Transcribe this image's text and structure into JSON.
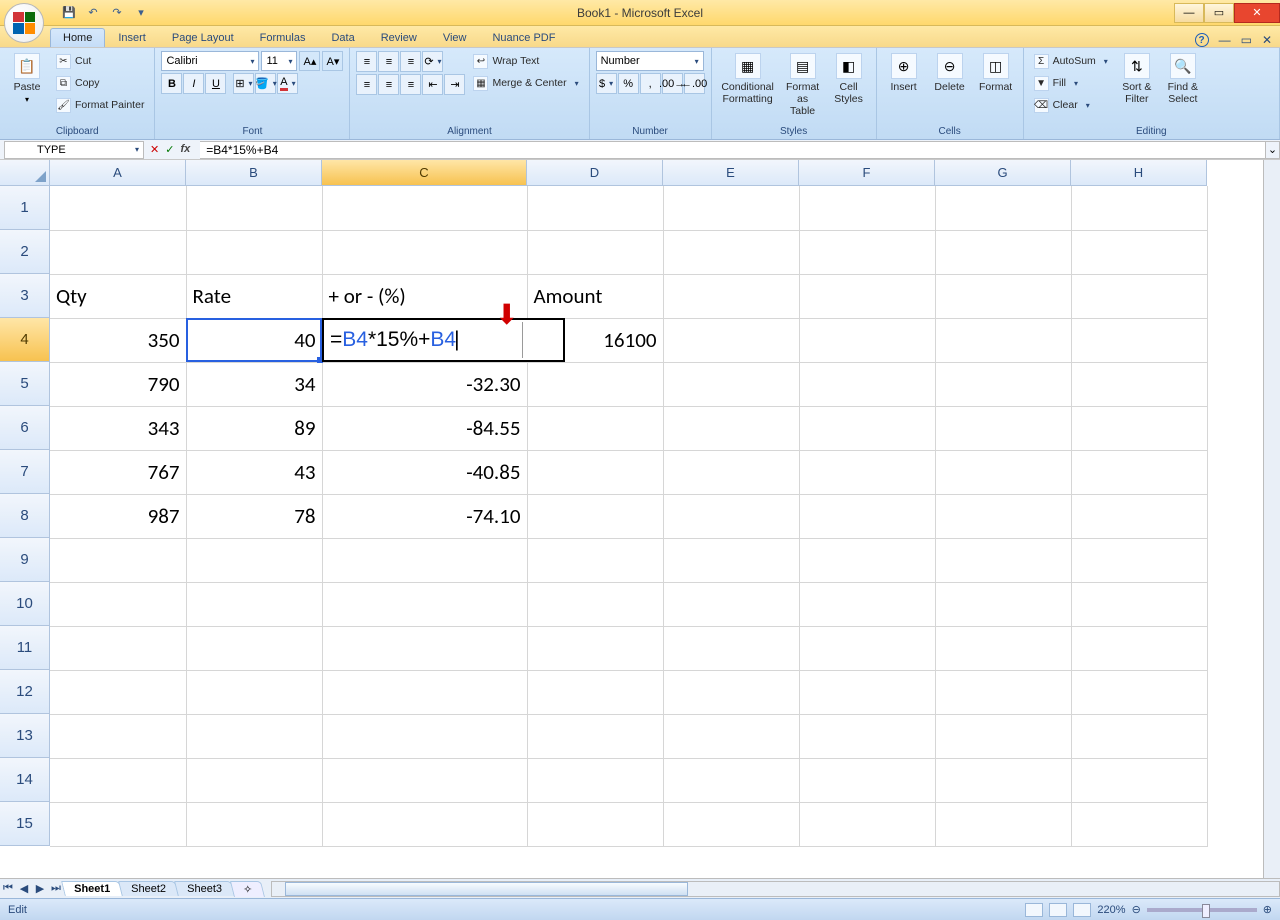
{
  "window": {
    "title": "Book1 - Microsoft Excel",
    "status_mode": "Edit",
    "zoom": "220%"
  },
  "tabs": {
    "items": [
      "Home",
      "Insert",
      "Page Layout",
      "Formulas",
      "Data",
      "Review",
      "View",
      "Nuance PDF"
    ],
    "active": "Home"
  },
  "ribbon": {
    "clipboard": {
      "title": "Clipboard",
      "paste": "Paste",
      "cut": "Cut",
      "copy": "Copy",
      "format_painter": "Format Painter"
    },
    "font": {
      "title": "Font",
      "name": "Calibri",
      "size": "11"
    },
    "alignment": {
      "title": "Alignment",
      "wrap": "Wrap Text",
      "merge": "Merge & Center"
    },
    "number": {
      "title": "Number",
      "format": "Number"
    },
    "styles": {
      "title": "Styles",
      "cond": "Conditional Formatting",
      "table": "Format as Table",
      "cell": "Cell Styles"
    },
    "cells": {
      "title": "Cells",
      "insert": "Insert",
      "delete": "Delete",
      "format": "Format"
    },
    "editing": {
      "title": "Editing",
      "autosum": "AutoSum",
      "fill": "Fill",
      "clear": "Clear",
      "sort": "Sort & Filter",
      "find": "Find & Select"
    }
  },
  "formula_bar": {
    "cell_ref": "TYPE",
    "formula": "=B4*15%+B4"
  },
  "columns": [
    "A",
    "B",
    "C",
    "D",
    "E",
    "F",
    "G",
    "H"
  ],
  "rows": [
    1,
    2,
    3,
    4,
    5,
    6,
    7,
    8,
    9,
    10,
    11,
    12,
    13,
    14,
    15
  ],
  "data": {
    "headers": {
      "A": "Qty",
      "B": "Rate",
      "C": "+ or - (%)",
      "D": "Amount"
    },
    "rows": {
      "4": {
        "A": "350",
        "B": "40",
        "C": "=B4*15%+B4",
        "D": "16100"
      },
      "5": {
        "A": "790",
        "B": "34",
        "C": "-32.30"
      },
      "6": {
        "A": "343",
        "B": "89",
        "C": "-84.55"
      },
      "7": {
        "A": "767",
        "B": "43",
        "C": "-40.85"
      },
      "8": {
        "A": "987",
        "B": "78",
        "C": "-74.10"
      }
    }
  },
  "edit_cell": {
    "ref": "C4",
    "parts": [
      {
        "text": "=",
        "style": ""
      },
      {
        "text": "B4",
        "style": "ref"
      },
      {
        "text": "*15%+",
        "style": ""
      },
      {
        "text": "B4",
        "style": "ref"
      }
    ]
  },
  "sheets": {
    "tabs": [
      "Sheet1",
      "Sheet2",
      "Sheet3"
    ],
    "active": "Sheet1"
  }
}
